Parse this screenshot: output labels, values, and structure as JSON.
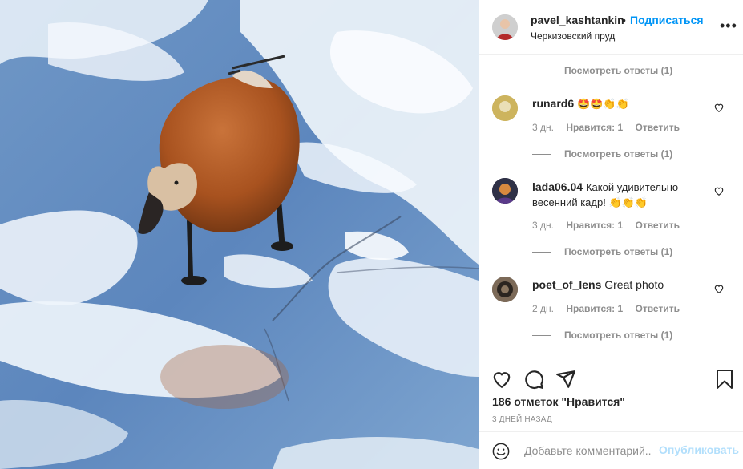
{
  "post": {
    "username": "pavel_kashtankin",
    "dot": "•",
    "follow_label": "Подписаться",
    "location": "Черкизовский пруд",
    "more_icon": "more-horizontal-icon"
  },
  "comments": [
    {
      "view_replies": "Посмотреть ответы (1)"
    },
    {
      "username": "runard6",
      "text": "🤩🤩👏👏",
      "time": "3 дн.",
      "likes": "Нравится: 1",
      "reply": "Ответить",
      "view_replies": "Посмотреть ответы (1)"
    },
    {
      "username": "lada06.04",
      "text": "Какой удивительно весенний кадр! 👏👏👏",
      "time": "3 дн.",
      "likes": "Нравится: 1",
      "reply": "Ответить",
      "view_replies": "Посмотреть ответы (1)"
    },
    {
      "username": "poet_of_lens",
      "text": "Great photo",
      "time": "2 дн.",
      "likes": "Нравится: 1",
      "reply": "Ответить",
      "view_replies": "Посмотреть ответы (1)"
    }
  ],
  "actions": {
    "like_icon": "heart-icon",
    "comment_icon": "comment-icon",
    "share_icon": "paper-plane-icon",
    "save_icon": "bookmark-icon",
    "likes_count": "186 отметок \"Нравится\"",
    "date": "3 ДНЕЙ НАЗАД"
  },
  "comment_box": {
    "placeholder": "Добавьте комментарий...",
    "publish_label": "Опубликовать"
  },
  "colors": {
    "link_blue": "#0095f6",
    "publish_disabled": "#b2dffc",
    "muted": "#8e8e8e",
    "text": "#262626"
  }
}
